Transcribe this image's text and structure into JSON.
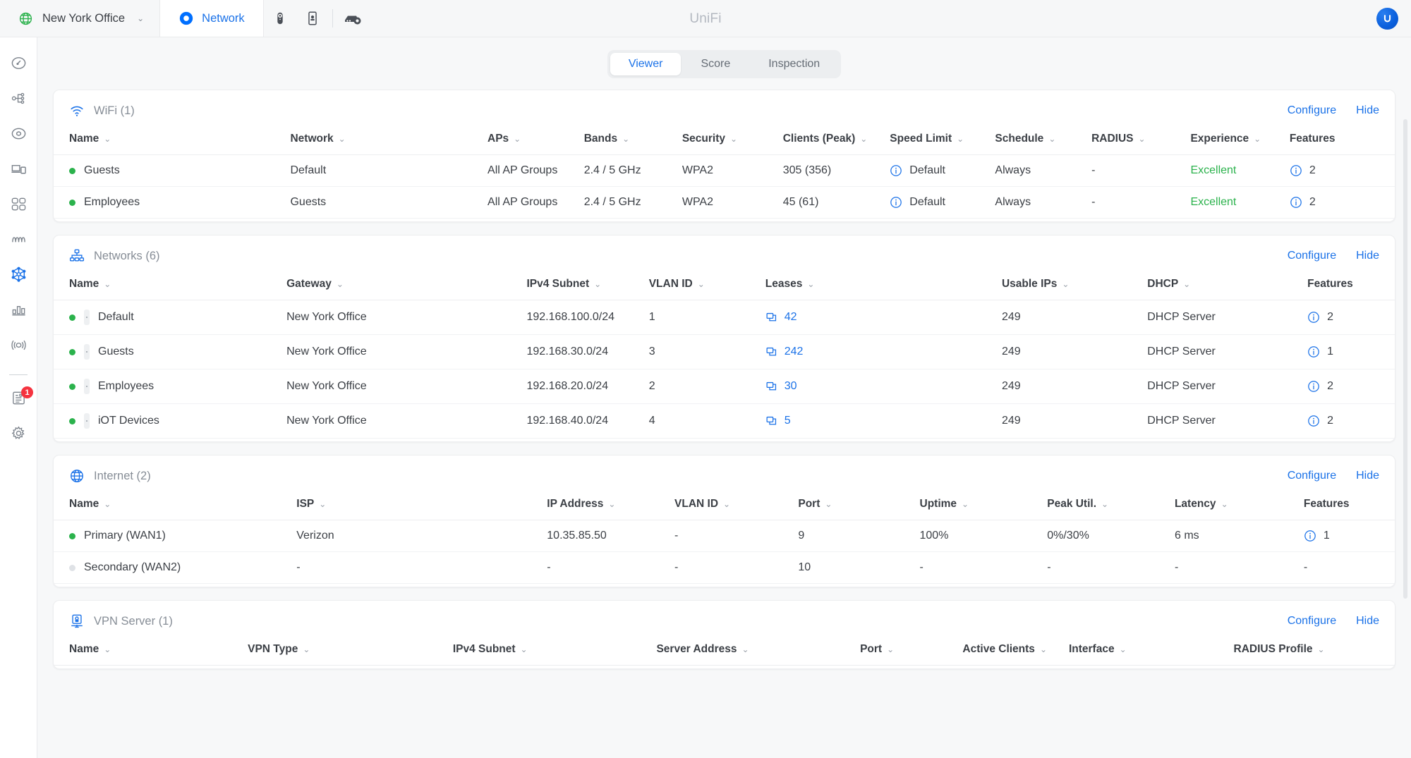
{
  "header": {
    "site_name": "New York Office",
    "site_caret": "⌄",
    "app_tab_label": "Network",
    "brand_title": "UniFi",
    "icons": [
      "globe-icon",
      "network-ring-icon",
      "protect-camera-icon",
      "access-door-icon",
      "device-settings-icon"
    ],
    "avatar_letter": "U"
  },
  "sidebar": {
    "items": [
      {
        "name": "dashboard-icon",
        "active": false
      },
      {
        "name": "topology-icon",
        "active": false
      },
      {
        "name": "unifi-devices-icon",
        "active": false
      },
      {
        "name": "client-devices-icon",
        "active": false
      },
      {
        "name": "clients-group-icon",
        "active": false
      },
      {
        "name": "insights-wave-icon",
        "active": false
      },
      {
        "name": "settings-network-icon",
        "active": true
      },
      {
        "name": "statistics-bar-icon",
        "active": false
      },
      {
        "name": "wifiman-radio-icon",
        "active": false
      }
    ],
    "logs": {
      "name": "system-log-icon",
      "badge": "1"
    },
    "settings": {
      "name": "gear-icon"
    }
  },
  "tabs": {
    "items": [
      {
        "label": "Viewer",
        "active": true
      },
      {
        "label": "Score",
        "active": false
      },
      {
        "label": "Inspection",
        "active": false
      }
    ]
  },
  "sections": [
    {
      "id": "wifi",
      "icon": "wifi-icon",
      "title": "WiFi (1)",
      "configure_label": "Configure",
      "hide_label": "Hide",
      "columns": [
        {
          "label": "Name",
          "sortable": true
        },
        {
          "label": "Network",
          "sortable": true
        },
        {
          "label": "APs",
          "sortable": true
        },
        {
          "label": "Bands",
          "sortable": true
        },
        {
          "label": "Security",
          "sortable": true
        },
        {
          "label": "Clients (Peak)",
          "sortable": true
        },
        {
          "label": "Speed Limit",
          "sortable": true
        },
        {
          "label": "Schedule",
          "sortable": true
        },
        {
          "label": "RADIUS",
          "sortable": true
        },
        {
          "label": "Experience",
          "sortable": true
        },
        {
          "label": "Features",
          "sortable": false
        }
      ],
      "rows": [
        {
          "status": "up",
          "name": "Guests",
          "network": "Default",
          "aps": "All AP Groups",
          "bands": "2.4 / 5 GHz",
          "security": "WPA2",
          "clients": "305 (356)",
          "speed_limit": "Default",
          "schedule": "Always",
          "radius": "-",
          "experience": "Excellent",
          "features": "2"
        },
        {
          "status": "up",
          "name": "Employees",
          "network": "Guests",
          "aps": "All AP Groups",
          "bands": "2.4 / 5 GHz",
          "security": "WPA2",
          "clients": "45 (61)",
          "speed_limit": "Default",
          "schedule": "Always",
          "radius": "-",
          "experience": "Excellent",
          "features": "2"
        }
      ]
    },
    {
      "id": "networks",
      "icon": "networks-icon",
      "title": "Networks (6)",
      "configure_label": "Configure",
      "hide_label": "Hide",
      "columns": [
        {
          "label": "Name",
          "sortable": true
        },
        {
          "label": "Gateway",
          "sortable": true
        },
        {
          "label": "IPv4 Subnet",
          "sortable": true
        },
        {
          "label": "VLAN ID",
          "sortable": true
        },
        {
          "label": "Leases",
          "sortable": true
        },
        {
          "label": "Usable IPs",
          "sortable": true
        },
        {
          "label": "DHCP",
          "sortable": true
        },
        {
          "label": "Features",
          "sortable": false
        }
      ],
      "rows": [
        {
          "status": "up",
          "handle": true,
          "name": "Default",
          "gateway": "New York Office",
          "subnet": "192.168.100.0/24",
          "vlan": "1",
          "leases": "42",
          "usable_ips": "249",
          "dhcp": "DHCP Server",
          "features": "2"
        },
        {
          "status": "up",
          "handle": true,
          "name": "Guests",
          "gateway": "New York Office",
          "subnet": "192.168.30.0/24",
          "vlan": "3",
          "leases": "242",
          "usable_ips": "249",
          "dhcp": "DHCP Server",
          "features": "1"
        },
        {
          "status": "up",
          "handle": true,
          "name": "Employees",
          "gateway": "New York Office",
          "subnet": "192.168.20.0/24",
          "vlan": "2",
          "leases": "30",
          "usable_ips": "249",
          "dhcp": "DHCP Server",
          "features": "2"
        },
        {
          "status": "up",
          "handle": true,
          "name": "iOT Devices",
          "gateway": "New York Office",
          "subnet": "192.168.40.0/24",
          "vlan": "4",
          "leases": "5",
          "usable_ips": "249",
          "dhcp": "DHCP Server",
          "features": "2"
        }
      ]
    },
    {
      "id": "internet",
      "icon": "internet-globe-icon",
      "title": "Internet (2)",
      "configure_label": "Configure",
      "hide_label": "Hide",
      "columns": [
        {
          "label": "Name",
          "sortable": true
        },
        {
          "label": "ISP",
          "sortable": true
        },
        {
          "label": "IP Address",
          "sortable": true
        },
        {
          "label": "VLAN ID",
          "sortable": true
        },
        {
          "label": "Port",
          "sortable": true
        },
        {
          "label": "Uptime",
          "sortable": true
        },
        {
          "label": "Peak Util.",
          "sortable": true
        },
        {
          "label": "Latency",
          "sortable": true
        },
        {
          "label": "Features",
          "sortable": false
        }
      ],
      "rows": [
        {
          "status": "up",
          "name": "Primary (WAN1)",
          "isp": "Verizon",
          "ip": "10.35.85.50",
          "vlan": "-",
          "port": "9",
          "uptime": "100%",
          "peak_util": "0%/30%",
          "latency": "6 ms",
          "features": "1"
        },
        {
          "status": "off",
          "name": "Secondary (WAN2)",
          "isp": "-",
          "ip": "-",
          "vlan": "-",
          "port": "10",
          "uptime": "-",
          "peak_util": "-",
          "latency": "-",
          "features": "-"
        }
      ]
    },
    {
      "id": "vpn",
      "icon": "vpn-server-icon",
      "title": "VPN Server (1)",
      "configure_label": "Configure",
      "hide_label": "Hide",
      "columns": [
        {
          "label": "Name",
          "sortable": true
        },
        {
          "label": "VPN Type",
          "sortable": true
        },
        {
          "label": "IPv4 Subnet",
          "sortable": true
        },
        {
          "label": "Server Address",
          "sortable": true
        },
        {
          "label": "Port",
          "sortable": true
        },
        {
          "label": "Active Clients",
          "sortable": true
        },
        {
          "label": "Interface",
          "sortable": true
        },
        {
          "label": "RADIUS Profile",
          "sortable": true
        }
      ],
      "rows": []
    }
  ],
  "colors": {
    "accent": "#1b72e8",
    "status_good": "#2bb24c",
    "status_off": "#dfe2e6",
    "badge_red": "#f5333f",
    "text": "#3b3f45",
    "muted": "#868d96"
  }
}
